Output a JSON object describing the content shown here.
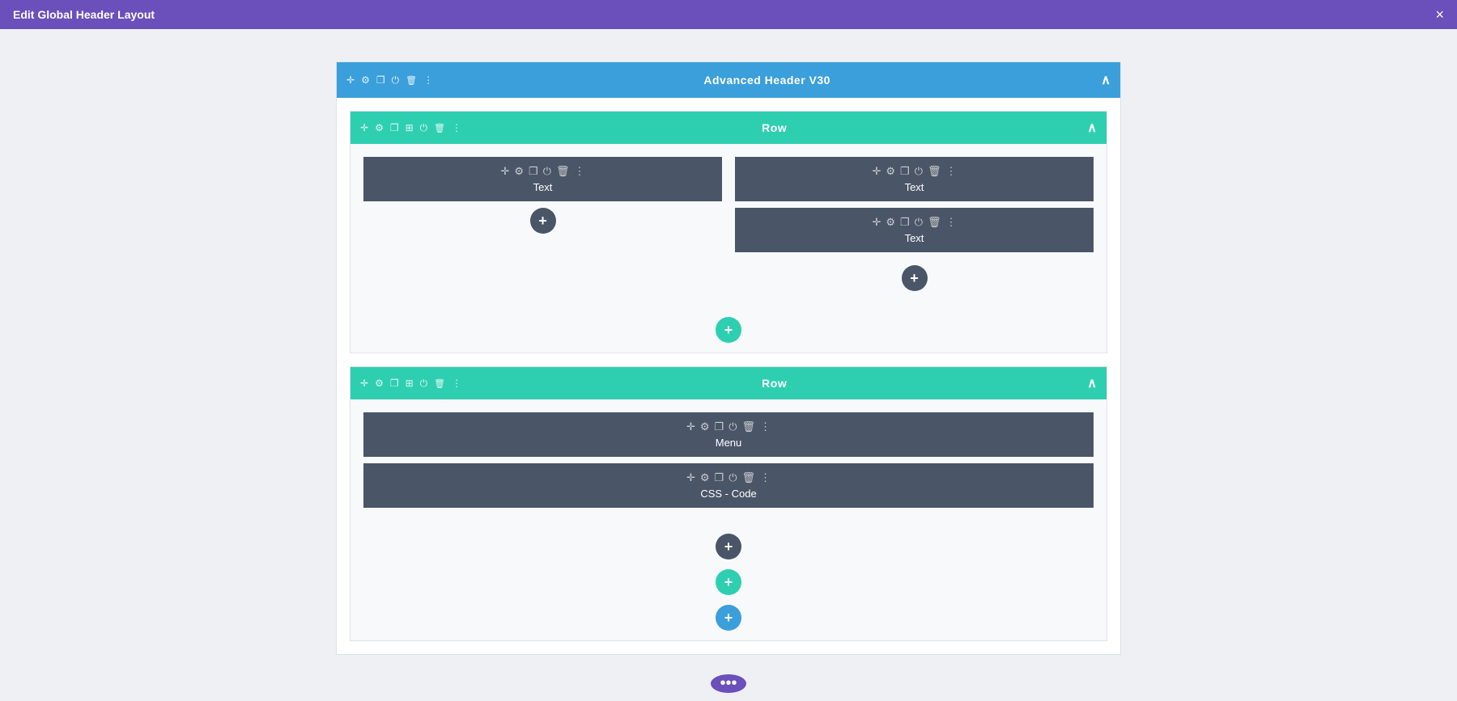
{
  "titleBar": {
    "title": "Edit Global Header Layout",
    "closeLabel": "×"
  },
  "outerBlock": {
    "headerBar": {
      "title": "Advanced Header V30",
      "icons": [
        "cross",
        "gear",
        "copy",
        "power",
        "trash",
        "dots"
      ],
      "chevron": "^"
    },
    "rows": [
      {
        "id": "row1",
        "barTitle": "Row",
        "barIcons": [
          "cross",
          "gear",
          "copy",
          "columns",
          "power",
          "trash",
          "dots"
        ],
        "columns": [
          {
            "id": "col1",
            "widgets": [
              {
                "id": "widget1",
                "icons": [
                  "+",
                  "0",
                  "0",
                  "0",
                  "@",
                  "!",
                  ":"
                ],
                "label": "Text"
              }
            ]
          },
          {
            "id": "col2",
            "widgets": [
              {
                "id": "widget2",
                "icons": [
                  "+",
                  "0",
                  "0",
                  "0",
                  "@",
                  ",",
                  ":"
                ],
                "label": "Text"
              },
              {
                "id": "widget3",
                "icons": [
                  "+",
                  "&",
                  "0",
                  "0",
                  "@",
                  ":",
                  ":"
                ],
                "label": "Text"
              }
            ]
          }
        ]
      },
      {
        "id": "row2",
        "barTitle": "Row",
        "barIcons": [
          "cross",
          "gear",
          "copy",
          "columns",
          "power",
          "trash",
          "dots"
        ],
        "singleWidgets": [
          {
            "id": "widget4",
            "icons": [
              "+",
              "0",
              "0",
              "0",
              "@",
              "!"
            ],
            "label": "Menu"
          },
          {
            "id": "widget5",
            "icons": [
              "+",
              "0",
              "0",
              "0",
              "@",
              "!"
            ],
            "label": "CSS - Code"
          }
        ]
      }
    ]
  },
  "addButtons": {
    "addRowLabel": "+",
    "addSectionLabel": "+",
    "addModuleLabel": "+"
  },
  "bottomDots": "•••"
}
